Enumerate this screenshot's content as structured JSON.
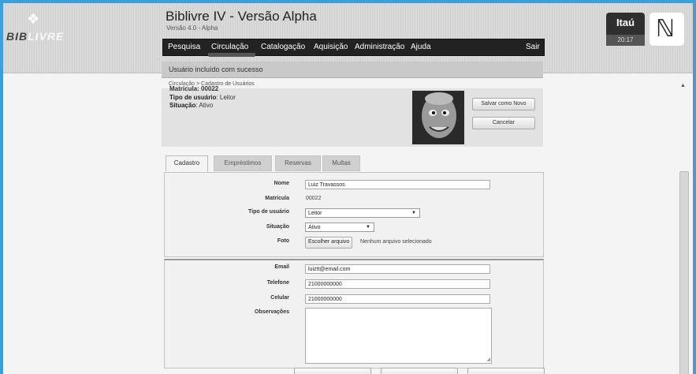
{
  "header": {
    "logo": {
      "prefix": "BIB",
      "suffix": "LIVRE"
    },
    "title": "Biblivre IV - Versão Alpha",
    "version": "Versão 4.0 - Alpha",
    "menu": [
      "Pesquisa",
      "Circulação",
      "Catalogação",
      "Aquisição",
      "Administração",
      "Ajuda"
    ],
    "logout": "Sair",
    "sponsor": "Itaú",
    "clock": "20:17"
  },
  "notice": "Usuário incluído com sucesso",
  "breadcrumb": "Circulação > Cadastro de Usuários",
  "summary": {
    "clipped_label": "Matrícula: 00022",
    "type_label": "Tipo de usuário",
    "type_value": "Leitor",
    "status_label": "Situação",
    "status_value": "Ativo",
    "save_new": "Salvar como Novo",
    "cancel": "Cancelar"
  },
  "tabs": [
    "Cadastro",
    "Empréstimos",
    "Reservas",
    "Multas"
  ],
  "form": {
    "name_label": "Nome",
    "name_value": "Luiz Travassos",
    "reg_label": "Matrícula",
    "reg_value": "00022",
    "type_label": "Tipo de usuário",
    "type_value": "Leitor",
    "status_label": "Situação",
    "status_value": "Ativo",
    "photo_label": "Foto",
    "file_button": "Escolher arquivo",
    "file_status": "Nenhum arquivo selecionado",
    "email_label": "Email",
    "email_value": "luiztt@email.com",
    "phone_label": "Telefone",
    "phone_value": "21000000000",
    "mobile_label": "Celular",
    "mobile_value": "21000000000",
    "notes_label": "Observações"
  }
}
